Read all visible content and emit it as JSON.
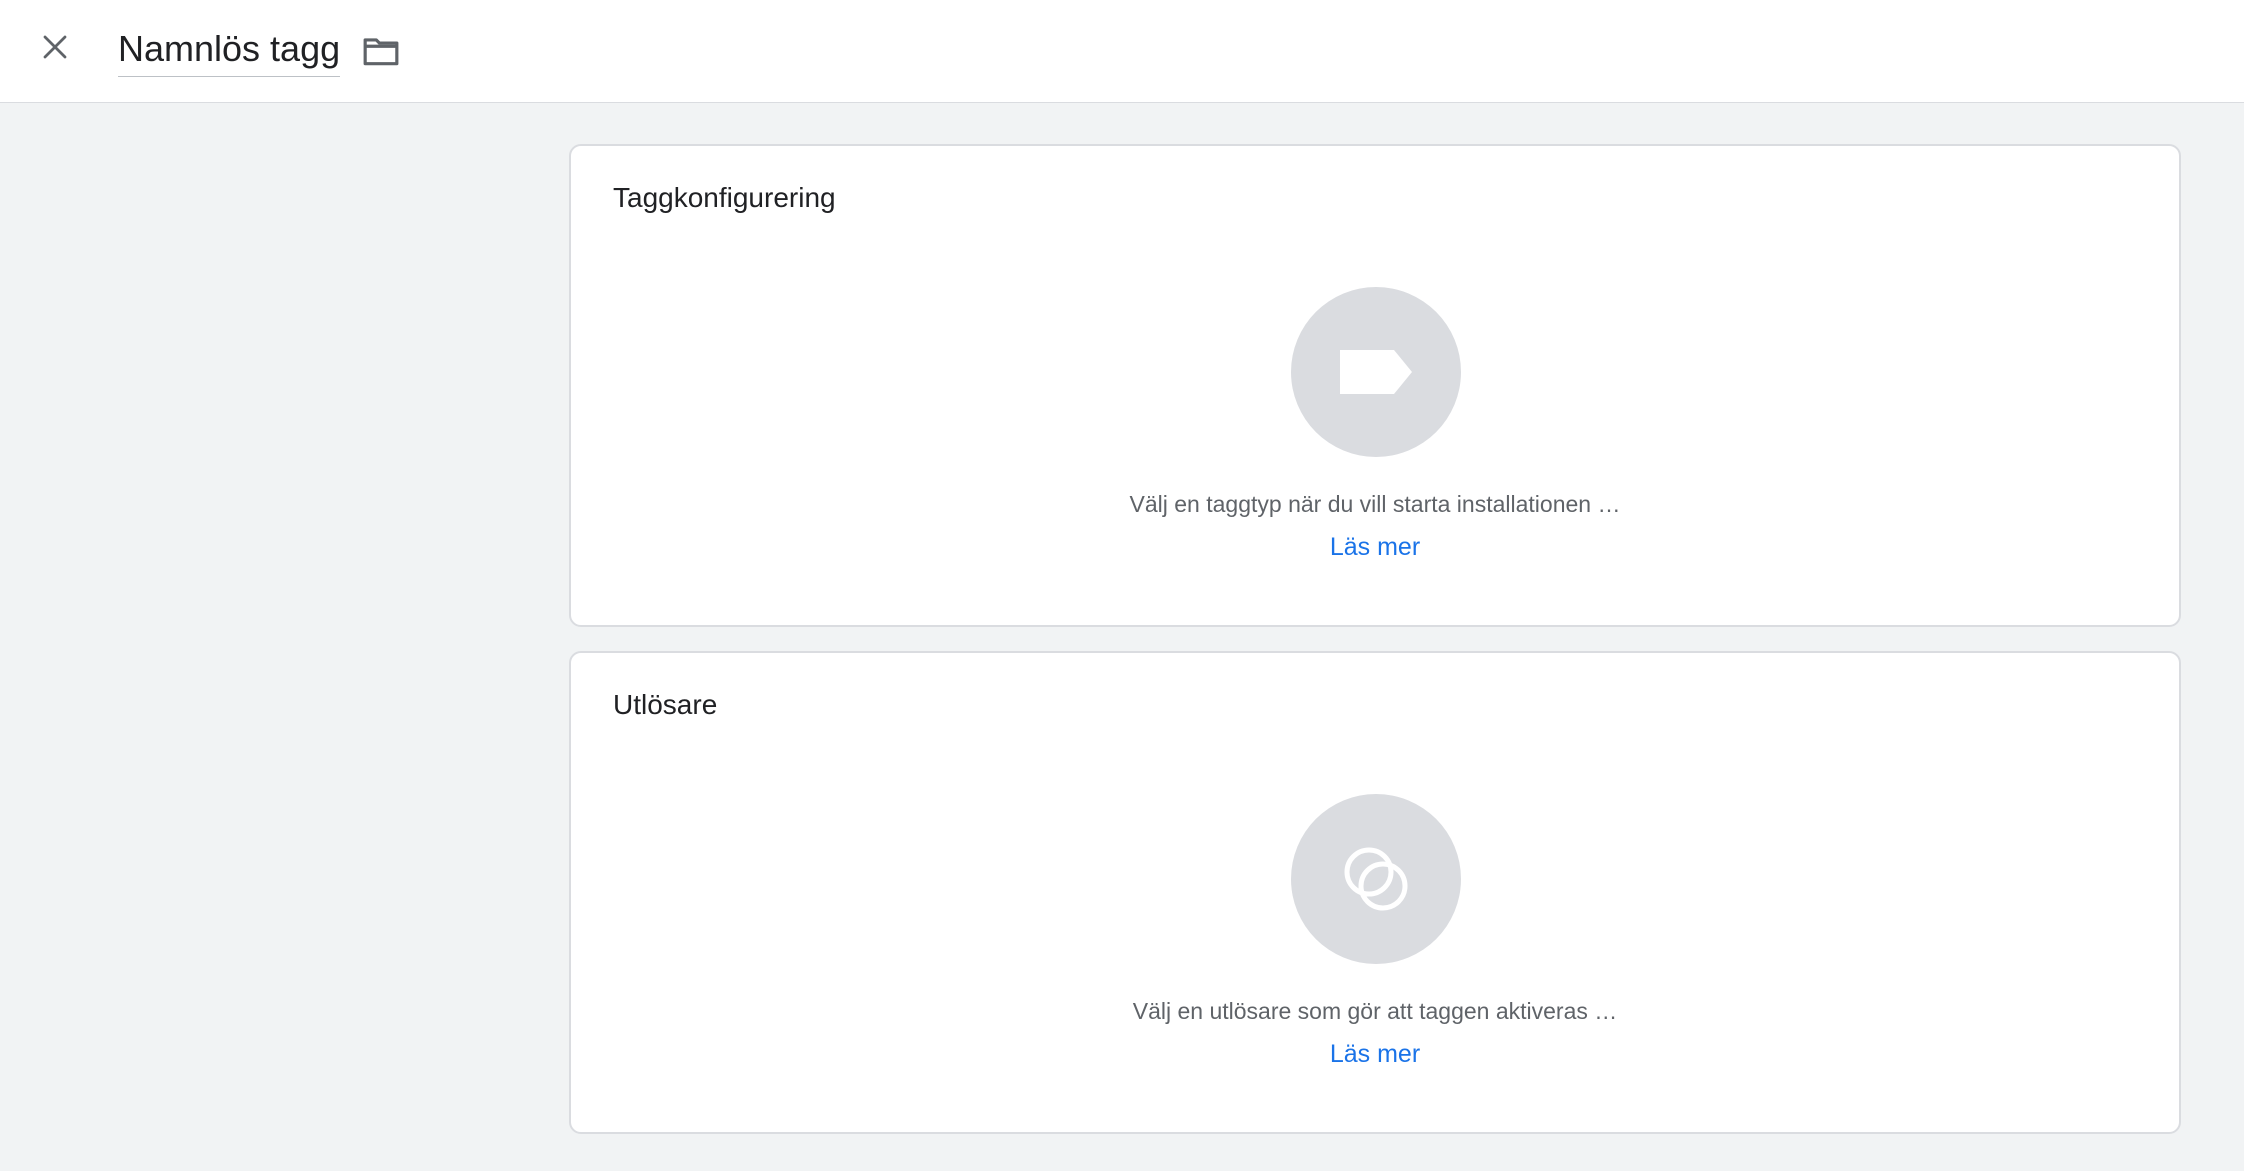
{
  "header": {
    "title": "Namnlös tagg",
    "close_icon": "close-icon",
    "folder_icon": "folder-icon"
  },
  "tag_configuration": {
    "title": "Taggkonfigurering",
    "icon": "tag-icon",
    "hint": "Välj en taggtyp när du vill starta installationen …",
    "learn_more": "Läs mer"
  },
  "triggering": {
    "title": "Utlösare",
    "icon": "trigger-icon",
    "hint": "Välj en utlösare som gör att taggen aktiveras …",
    "learn_more": "Läs mer"
  },
  "colors": {
    "background": "#f1f3f4",
    "card": "#ffffff",
    "placeholder_circle": "#dadce0",
    "link": "#1a73e8"
  }
}
